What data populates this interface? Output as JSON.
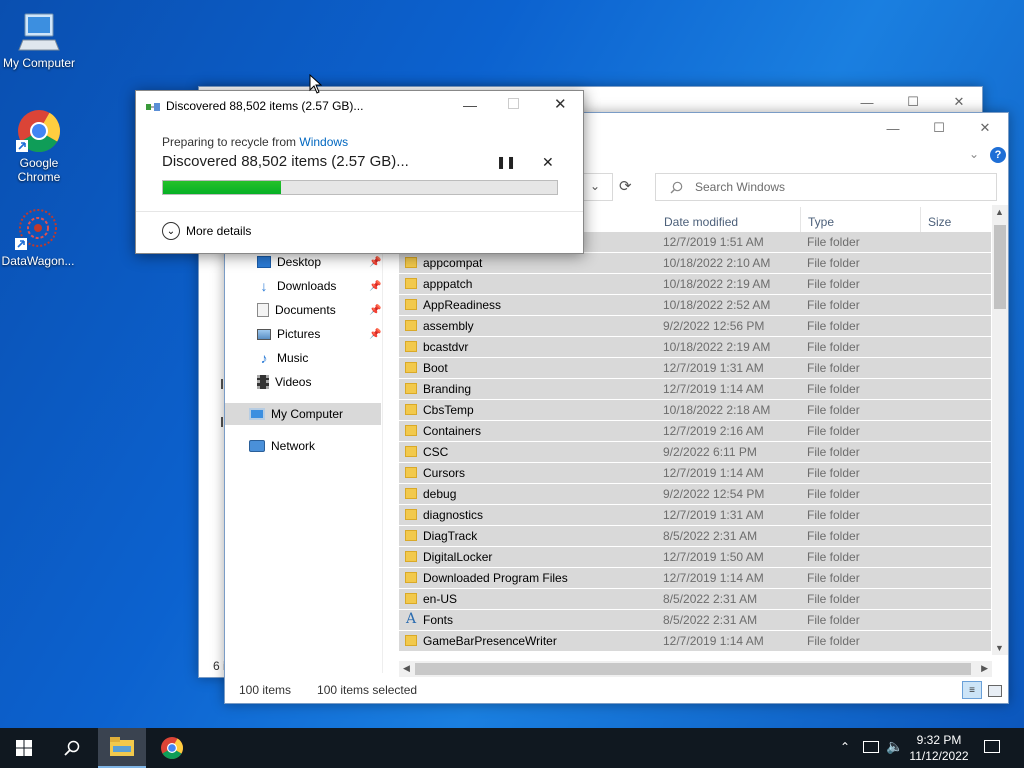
{
  "desktop": {
    "icons": [
      {
        "label": "My Computer"
      },
      {
        "label": "Google Chrome"
      },
      {
        "label": "DataWagon..."
      }
    ]
  },
  "back_window": {
    "status_fragment": "6 i"
  },
  "explorer": {
    "search_placeholder": "Search Windows",
    "columns": {
      "date": "Date modified",
      "type": "Type",
      "size": "Size"
    },
    "nav": {
      "desktop": "Desktop",
      "downloads": "Downloads",
      "documents": "Documents",
      "pictures": "Pictures",
      "music": "Music",
      "videos": "Videos",
      "my_computer": "My Computer",
      "network": "Network"
    },
    "files": [
      {
        "name": "appcompat",
        "date": "10/18/2022 2:10 AM",
        "type": "File folder"
      },
      {
        "name": "apppatch",
        "date": "10/18/2022 2:19 AM",
        "type": "File folder"
      },
      {
        "name": "AppReadiness",
        "date": "10/18/2022 2:52 AM",
        "type": "File folder"
      },
      {
        "name": "assembly",
        "date": "9/2/2022 12:56 PM",
        "type": "File folder"
      },
      {
        "name": "bcastdvr",
        "date": "10/18/2022 2:19 AM",
        "type": "File folder"
      },
      {
        "name": "Boot",
        "date": "12/7/2019 1:31 AM",
        "type": "File folder"
      },
      {
        "name": "Branding",
        "date": "12/7/2019 1:14 AM",
        "type": "File folder"
      },
      {
        "name": "CbsTemp",
        "date": "10/18/2022 2:18 AM",
        "type": "File folder"
      },
      {
        "name": "Containers",
        "date": "12/7/2019 2:16 AM",
        "type": "File folder"
      },
      {
        "name": "CSC",
        "date": "9/2/2022 6:11 PM",
        "type": "File folder"
      },
      {
        "name": "Cursors",
        "date": "12/7/2019 1:14 AM",
        "type": "File folder"
      },
      {
        "name": "debug",
        "date": "9/2/2022 12:54 PM",
        "type": "File folder"
      },
      {
        "name": "diagnostics",
        "date": "12/7/2019 1:31 AM",
        "type": "File folder"
      },
      {
        "name": "DiagTrack",
        "date": "8/5/2022 2:31 AM",
        "type": "File folder"
      },
      {
        "name": "DigitalLocker",
        "date": "12/7/2019 1:50 AM",
        "type": "File folder"
      },
      {
        "name": "Downloaded Program Files",
        "date": "12/7/2019 1:14 AM",
        "type": "File folder"
      },
      {
        "name": "en-US",
        "date": "8/5/2022 2:31 AM",
        "type": "File folder"
      },
      {
        "name": "Fonts",
        "date": "8/5/2022 2:31 AM",
        "type": "File folder"
      },
      {
        "name": "GameBarPresenceWriter",
        "date": "12/7/2019 1:14 AM",
        "type": "File folder"
      }
    ],
    "partial_row": {
      "date": "12/7/2019 1:51 AM",
      "type": "File folder"
    },
    "status": {
      "count": "100 items",
      "selected": "100 items selected"
    }
  },
  "dialog": {
    "title": "Discovered 88,502 items (2.57 GB)...",
    "prep_prefix": "Preparing to recycle from ",
    "prep_link": "Windows",
    "headline": "Discovered 88,502 items (2.57 GB)...",
    "progress": 0.3,
    "more_details": "More details"
  },
  "taskbar": {
    "time": "9:32 PM",
    "date": "11/12/2022"
  },
  "colors": {
    "accent": "#0067c0",
    "progress": "#06b025",
    "selection": "#d9d9d9"
  }
}
